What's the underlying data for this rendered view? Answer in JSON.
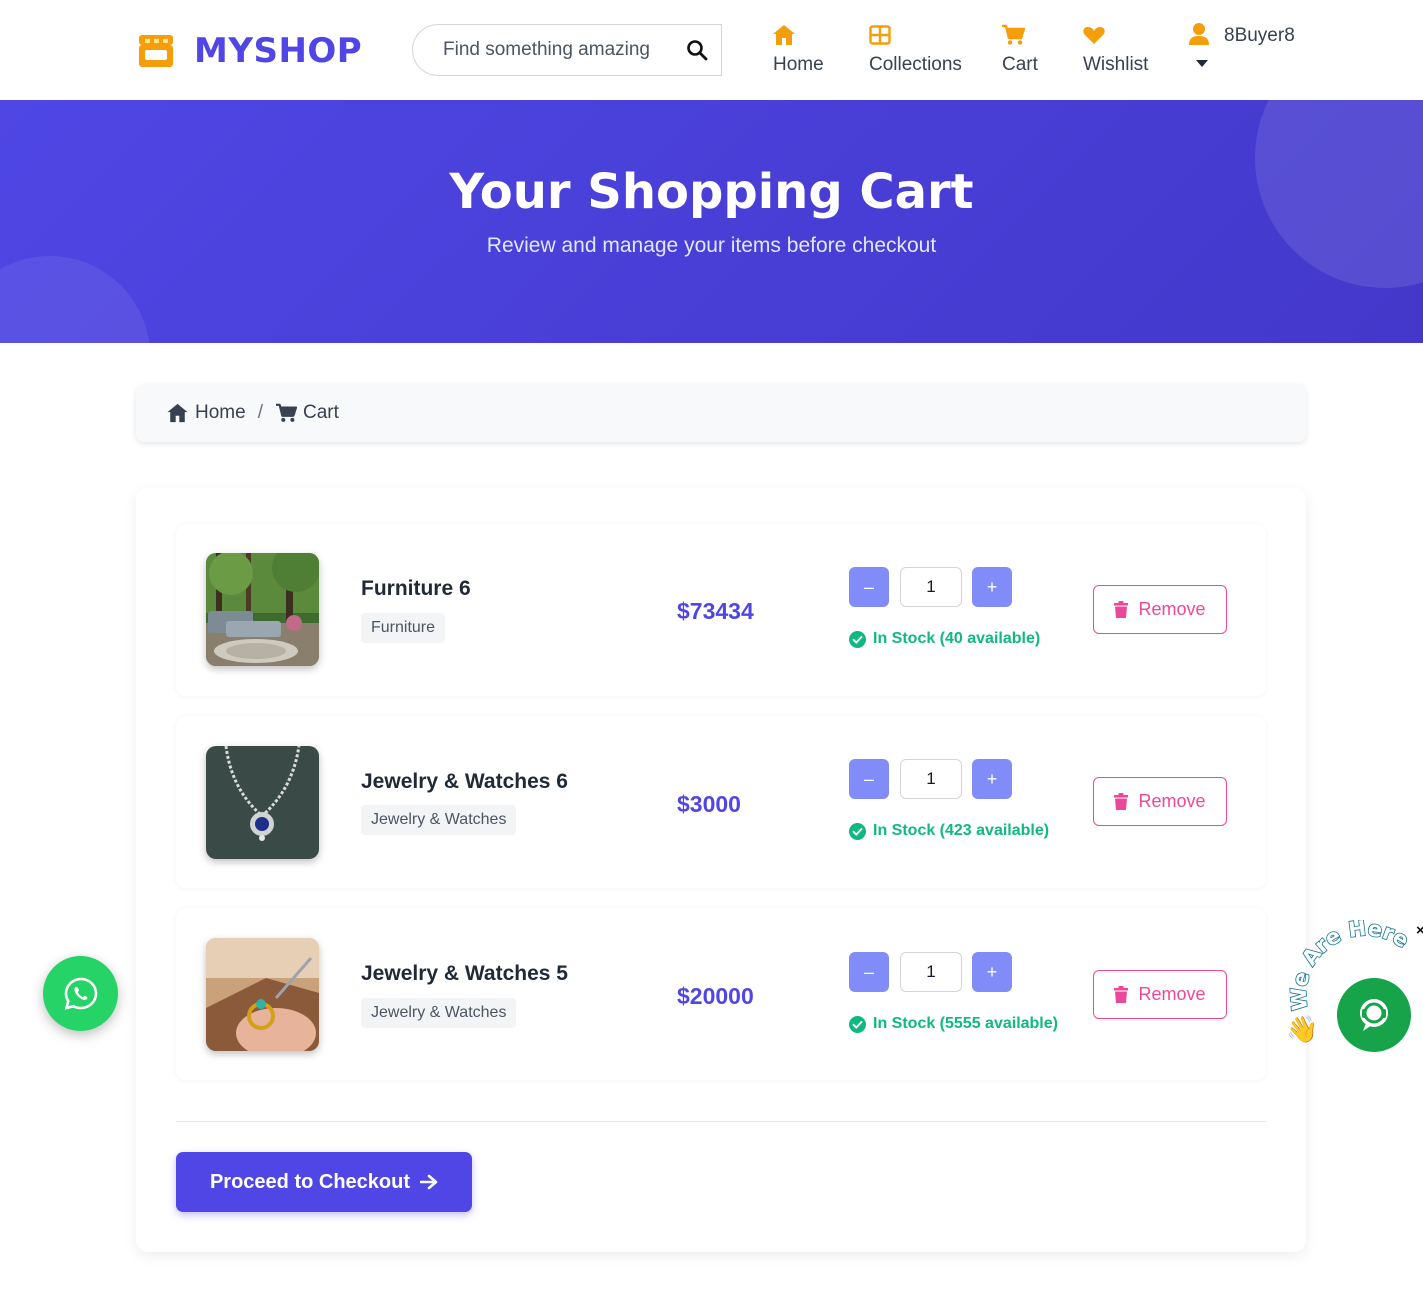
{
  "header": {
    "brand": "MYSHOP",
    "search": {
      "placeholder": "Find something amazing",
      "value": ""
    },
    "nav": [
      {
        "label": "Home",
        "icon": "home-icon"
      },
      {
        "label": "Collections",
        "icon": "grid-icon"
      },
      {
        "label": "Cart",
        "icon": "cart-icon"
      },
      {
        "label": "Wishlist",
        "icon": "heart-icon"
      }
    ],
    "user": {
      "name": "8Buyer8",
      "icon": "user-icon"
    }
  },
  "hero": {
    "title": "Your Shopping Cart",
    "subtitle": "Review and manage your items before checkout"
  },
  "breadcrumb": {
    "home": "Home",
    "separator": "/",
    "current": "Cart"
  },
  "cart": {
    "items": [
      {
        "name": "Furniture 6",
        "category": "Furniture",
        "price": "$73434",
        "quantity": "1",
        "stock": "In Stock (40 available)",
        "remove_label": "Remove"
      },
      {
        "name": "Jewelry & Watches 6",
        "category": "Jewelry & Watches",
        "price": "$3000",
        "quantity": "1",
        "stock": "In Stock (423 available)",
        "remove_label": "Remove"
      },
      {
        "name": "Jewelry & Watches 5",
        "category": "Jewelry & Watches",
        "price": "$20000",
        "quantity": "1",
        "stock": "In Stock (5555 available)",
        "remove_label": "Remove"
      }
    ],
    "checkout_label": "Proceed to Checkout"
  },
  "widgets": {
    "chat_label": "We Are Here",
    "close": "×"
  },
  "colors": {
    "primary": "#4f46e5",
    "accent_orange": "#f59e0b",
    "success": "#10b981",
    "danger": "#ec4899",
    "whatsapp": "#25d366"
  }
}
